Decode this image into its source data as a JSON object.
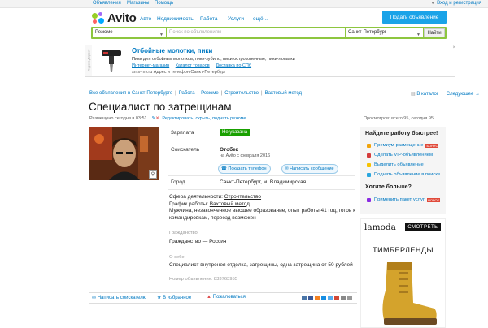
{
  "topbar": {
    "links": [
      "Объявления",
      "Магазины",
      "Помощь"
    ],
    "login": "Вход и регистрация"
  },
  "logo": {
    "text": "Avito"
  },
  "nav": [
    "Авто",
    "Недвижимость",
    "Работа",
    "Услуги",
    "ещё..."
  ],
  "post_button": "Подать объявление",
  "search": {
    "category": "Резюме",
    "placeholder": "Поиск по объявлениям",
    "city": "Санкт-Петербург",
    "button": "Найти"
  },
  "ad": {
    "side_label": "Яндекс.Директ",
    "title": "Отбойные молотки, пики",
    "description": "Пики для отбойных молотков, пики-зубило, пики остроконечные, пики-лопатки",
    "links": [
      "Интернет-магазин",
      "Каталог товаров",
      "Доставка по СПб"
    ],
    "site": "sms-mv.ru   Адрес и телефон   Санкт-Петербург",
    "close": "×"
  },
  "breadcrumbs": [
    "Все объявления в Санкт-Петербурге",
    "Работа",
    "Резюме",
    "Строительство",
    "Вахтовый метод"
  ],
  "pager": {
    "catalog": "В каталог",
    "next": "Следующее →"
  },
  "title": "Специалист по затрещинам",
  "meta": {
    "posted": "Размещено сегодня в 03:51.",
    "edit": "Редактировать, скрыть, поднять резюме"
  },
  "views": "Просмотров: всего 95, сегодня 95",
  "details": {
    "salary_label": "Зарплата",
    "salary_value": "Не указана",
    "seeker_label": "Соискатель",
    "seeker_name": "Отобек",
    "seeker_since": "на Avito с февраля 2016",
    "show_phone": "Показать телефон",
    "write_message": "Написать сообщение",
    "city_label": "Город",
    "city_value": "Санкт-Петербург, м. Владимирская"
  },
  "info": {
    "line1_prefix": "Сфера деятельности: ",
    "line1_value": "Строительство",
    "line2_prefix": "График работы: ",
    "line2_value": "Вахтовый метод",
    "line3": "Мужчина, незаконченное высшее образование, опыт работы 41 год, готов к",
    "line4": "командировкам, переезд возможен"
  },
  "citizenship": {
    "heading": "Гражданство",
    "value": "Гражданство — Россия"
  },
  "about": {
    "heading": "О себе",
    "value": "Специалист внутренея отделка, затрещины, одна затрещина от 50 рублей"
  },
  "ad_number": "Номер объявления: 833763955",
  "bottom": {
    "write": "Написать соискателю",
    "favorite": "В избранное",
    "complain": "Пожаловаться"
  },
  "sidebar": {
    "title": "Найдите работу быстрее!",
    "items": [
      "Премиум-размещение",
      "Сделать VIP-объявлением",
      "Выделить объявление",
      "Поднять объявление в поиске"
    ],
    "premium_badge": "БОНУС",
    "title2": "Хотите больше?",
    "item2": "Применить пакет услуг",
    "item2_badge": "НОВОЕ"
  },
  "banner": {
    "brand": "lamoda",
    "button": "СМОТРЕТЬ",
    "subtitle": "ТИМБЕРЛЕНДЫ"
  },
  "colors": {
    "link": "#0079c2",
    "brand_green": "#8dc63f",
    "badge_green": "#19a000",
    "post_button": "#1aa3e8"
  }
}
